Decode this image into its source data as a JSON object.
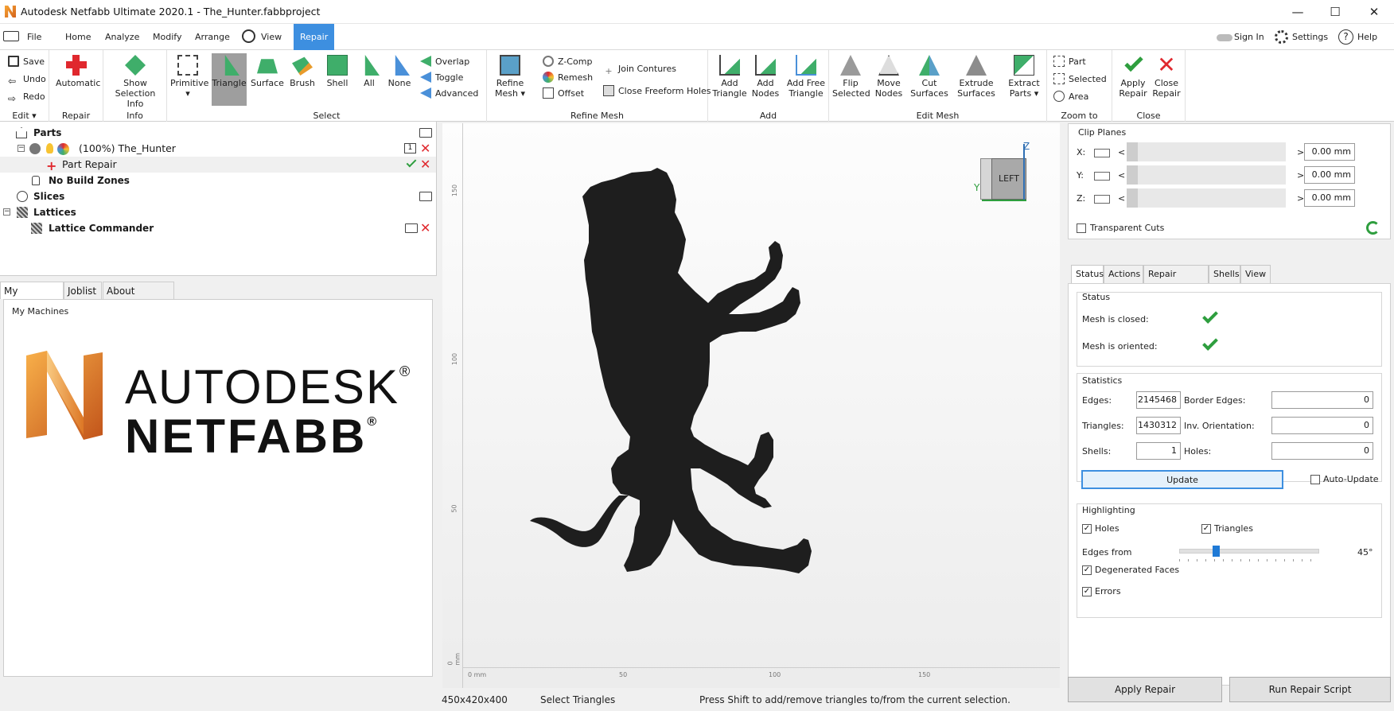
{
  "window": {
    "title": "Autodesk Netfabb Ultimate 2020.1 - The_Hunter.fabbproject",
    "min": "—",
    "max": "☐",
    "close": "✕"
  },
  "menu": {
    "file": "File",
    "tabs": [
      "Home",
      "Analyze",
      "Modify",
      "Arrange",
      "View",
      "Repair"
    ],
    "active": "Repair",
    "signin": "Sign In",
    "settings": "Settings",
    "help": "Help"
  },
  "ribbon": {
    "edit": {
      "save": "Save",
      "undo": "Undo",
      "redo": "Redo",
      "group": "Edit ▾"
    },
    "repair": {
      "automatic": "Automatic",
      "group": "Repair"
    },
    "info": {
      "show1": "Show",
      "show2": "Selection Info",
      "group": "Info"
    },
    "select": {
      "primitive": "Primitive",
      "triangle": "Triangle",
      "surface": "Surface",
      "brush": "Brush",
      "shell": "Shell",
      "all": "All",
      "none": "None",
      "overlap": "Overlap",
      "toggle": "Toggle",
      "advanced": "Advanced",
      "group": "Select"
    },
    "refine": {
      "refine1": "Refine",
      "refine2": "Mesh ▾",
      "zcomp": "Z-Comp",
      "remesh": "Remesh",
      "offset": "Offset",
      "join": "Join Contures",
      "close": "Close Freeform Holes",
      "group": "Refine Mesh"
    },
    "add": {
      "tri1": "Add",
      "tri2": "Triangle",
      "nodes1": "Add",
      "nodes2": "Nodes",
      "free1": "Add Free",
      "free2": "Triangle",
      "group": "Add"
    },
    "editmesh": {
      "flip1": "Flip",
      "flip2": "Selected",
      "move1": "Move",
      "move2": "Nodes",
      "cut1": "Cut",
      "cut2": "Surfaces",
      "ext1": "Extrude",
      "ext2": "Surfaces",
      "extract1": "Extract",
      "extract2": "Parts ▾",
      "group": "Edit Mesh"
    },
    "zoom": {
      "part": "Part",
      "selected": "Selected",
      "area": "Area",
      "group": "Zoom to"
    },
    "close": {
      "apply1": "Apply",
      "apply2": "Repair",
      "close1": "Close",
      "close2": "Repair",
      "group": "Close"
    }
  },
  "tree": {
    "parts": "Parts",
    "hunter": "(100%) The_Hunter",
    "badge": "1",
    "part_repair": "Part Repair",
    "nobuild": "No Build Zones",
    "slices": "Slices",
    "lattices": "Lattices",
    "lattice_commander": "Lattice Commander"
  },
  "left_tabs": [
    "My Machines",
    "Joblist",
    "About Ribbons"
  ],
  "machines": {
    "group": "My Machines",
    "brand1": "AUTODESK",
    "brand2": "NETFABB",
    "reg": "®"
  },
  "viewport": {
    "cube_face": "LEFT",
    "axis_z": "Z",
    "axis_y": "Y",
    "v_ticks": [
      "150",
      "100",
      "50",
      "0 mm"
    ],
    "h_ticks": [
      "0 mm",
      "50",
      "100",
      "150"
    ]
  },
  "status": {
    "size": "450x420x400",
    "mode": "Select Triangles",
    "hint": "Press Shift to add/remove triangles to/from the current selection."
  },
  "clip": {
    "title": "Clip Planes",
    "x": "X:",
    "y": "Y:",
    "z": "Z:",
    "xv": "0.00 mm",
    "yv": "0.00 mm",
    "zv": "0.00 mm",
    "transparent": "Transparent Cuts",
    "lt": "<",
    "gt": ">"
  },
  "rtabs": [
    "Status",
    "Actions",
    "Repair Scripts",
    "Shells",
    "View"
  ],
  "status_panel": {
    "title": "Status",
    "closed": "Mesh is closed:",
    "oriented": "Mesh is oriented:"
  },
  "stats": {
    "title": "Statistics",
    "edges": "Edges:",
    "edges_v": "2145468",
    "border": "Border Edges:",
    "border_v": "0",
    "triangles": "Triangles:",
    "triangles_v": "1430312",
    "inv": "Inv. Orientation:",
    "inv_v": "0",
    "shells": "Shells:",
    "shells_v": "1",
    "holes": "Holes:",
    "holes_v": "0",
    "update": "Update",
    "auto": "Auto-Update"
  },
  "highlight": {
    "title": "Highlighting",
    "holes": "Holes",
    "triangles": "Triangles",
    "edges_from": "Edges from",
    "angle": "45°",
    "angle_frac": 0.25,
    "degen": "Degenerated Faces",
    "errors": "Errors"
  },
  "bottom": {
    "apply": "Apply Repair",
    "run": "Run Repair Script"
  }
}
